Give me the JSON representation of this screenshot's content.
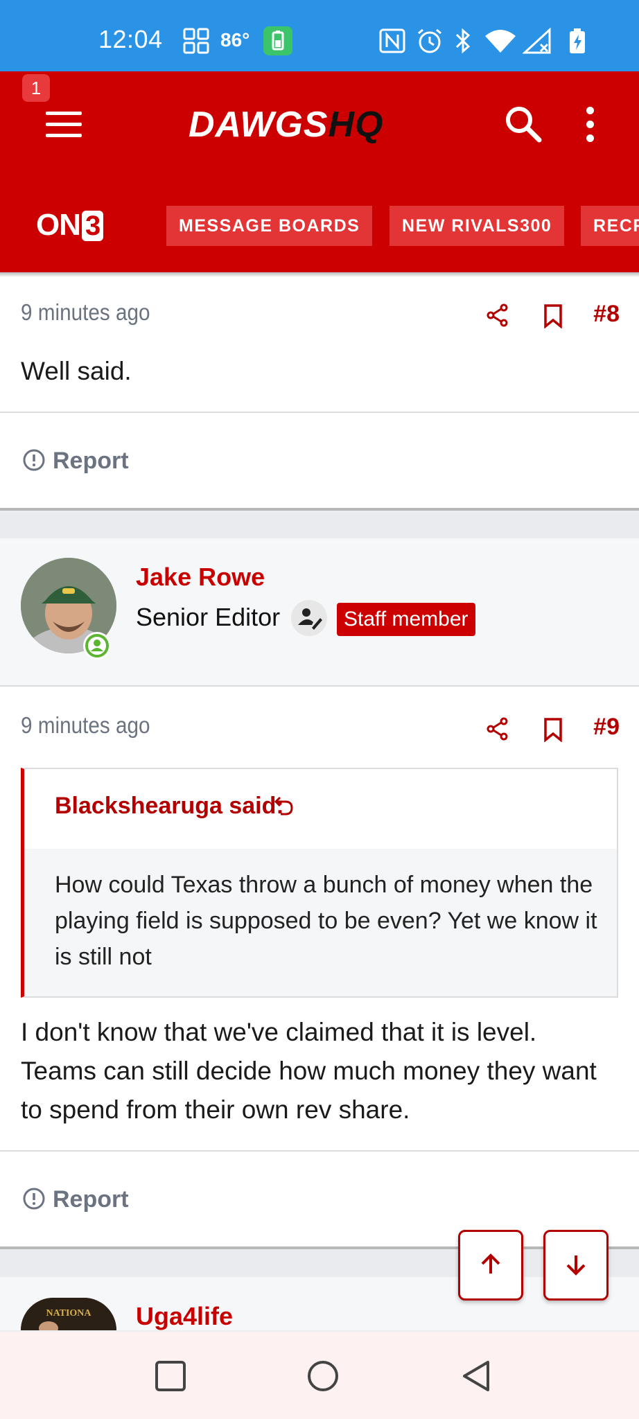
{
  "status_bar": {
    "time": "12:04",
    "temperature": "86°",
    "icons": [
      "grid-icon",
      "battery-saver-icon",
      "nfc-icon",
      "alarm-icon",
      "bluetooth-icon",
      "wifi-icon",
      "signal-icon",
      "battery-charging-icon"
    ]
  },
  "header": {
    "notification_count": "1",
    "logo_main": "DAWGS",
    "logo_hq": "HQ",
    "brand": "ON",
    "brand_num": "3",
    "tabs": [
      {
        "label": "MESSAGE BOARDS"
      },
      {
        "label": "NEW RIVALS300"
      },
      {
        "label": "RECR"
      }
    ]
  },
  "posts": [
    {
      "time": "9 minutes ago",
      "number": "#8",
      "body": "Well said.",
      "report_label": "Report"
    },
    {
      "author": "Jake Rowe",
      "role": "Senior Editor",
      "badge": "Staff member",
      "time": "9 minutes ago",
      "number": "#9",
      "quote_author": "Blackshearuga said:",
      "quote_text": "How could Texas throw a bunch of money when the playing field is supposed to be even? Yet we know it is still not",
      "body": "I don't know that we've claimed that it is level. Teams can still decide how much money they want to spend from their own rev share.",
      "report_label": "Report"
    },
    {
      "author": "Uga4life"
    }
  ],
  "colors": {
    "accent": "#cc0000",
    "status_bar": "#2b93e6",
    "muted_text": "#6b7280"
  }
}
